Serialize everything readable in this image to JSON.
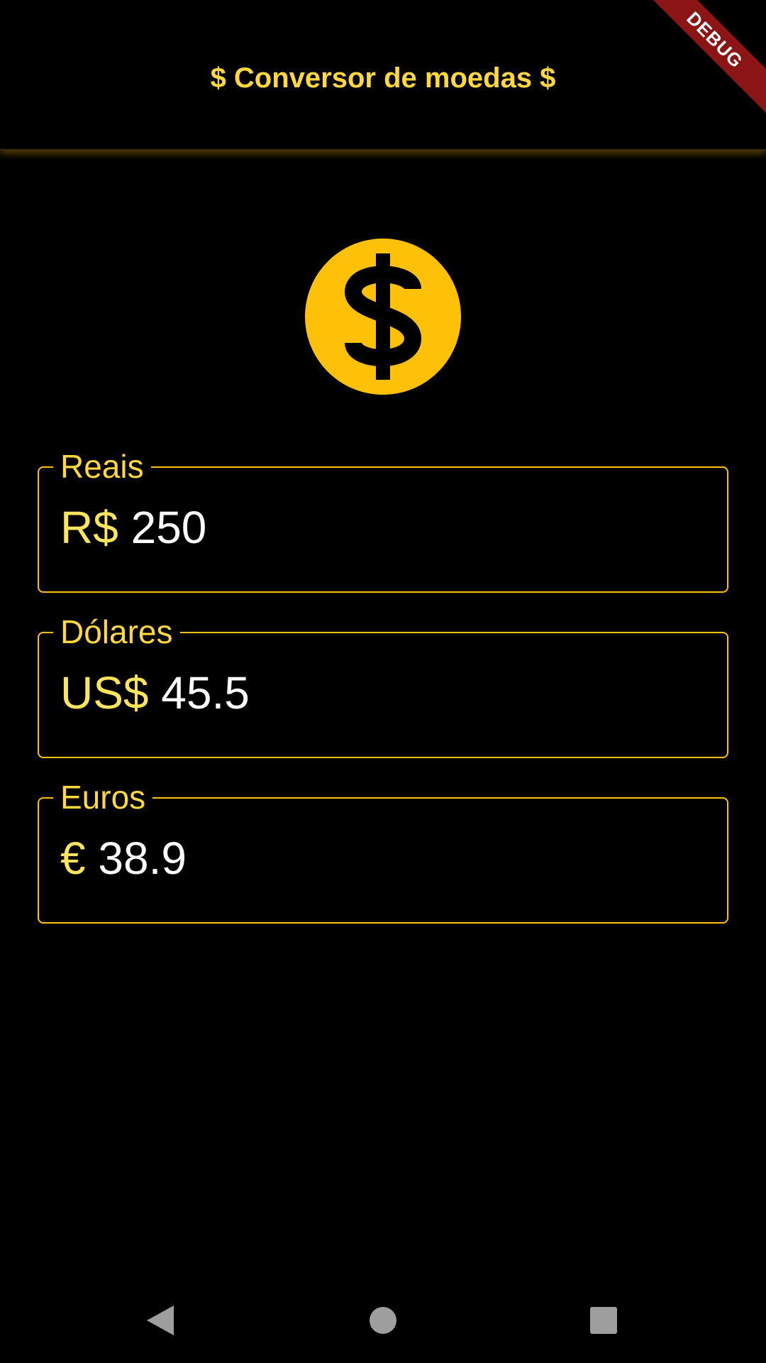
{
  "app_bar": {
    "title": "$ Conversor de moedas $"
  },
  "debug_banner": {
    "label": "DEBUG"
  },
  "icon": {
    "name": "dollar-circle-icon",
    "color": "#FFC107"
  },
  "fields": [
    {
      "label": "Reais",
      "prefix": "R$ ",
      "value": "250"
    },
    {
      "label": "Dólares",
      "prefix": "US$ ",
      "value": "45.5"
    },
    {
      "label": "Euros",
      "prefix": "€ ",
      "value": "38.9"
    }
  ],
  "colors": {
    "accent": "#FFC107",
    "label": "#FFD740",
    "background": "#000000",
    "debug_banner": "#8B1515"
  },
  "nav_bar": {
    "buttons": [
      "back-icon",
      "home-icon",
      "recents-icon"
    ]
  }
}
